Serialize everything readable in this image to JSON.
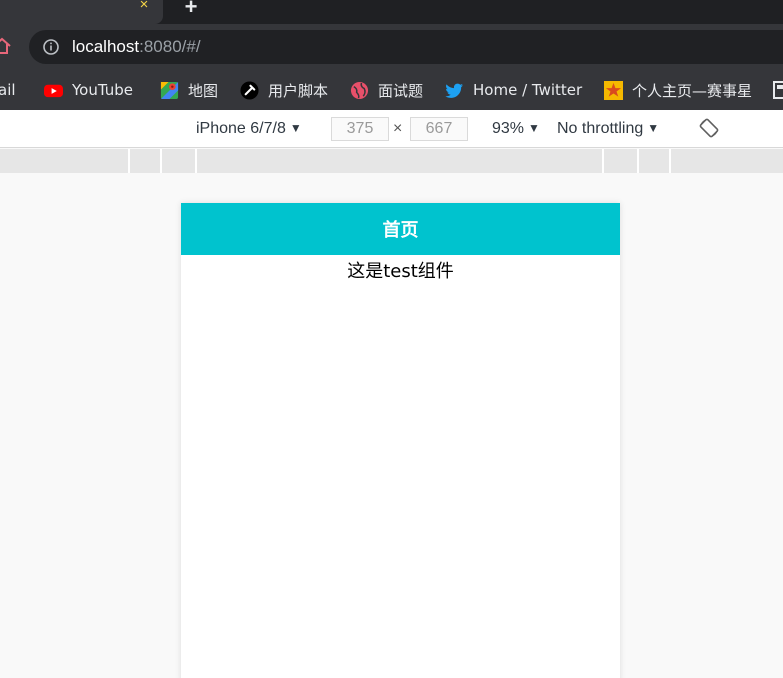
{
  "browser": {
    "tab_close_glyph": "×",
    "new_tab_glyph": "+",
    "address": {
      "host": "localhost",
      "rest": ":8080/#/"
    }
  },
  "bookmarks": [
    {
      "label": "ail",
      "icon": "gmail-icon"
    },
    {
      "label": "YouTube",
      "icon": "youtube-icon"
    },
    {
      "label": "地图",
      "icon": "maps-icon"
    },
    {
      "label": "用户脚本",
      "icon": "userscript-icon"
    },
    {
      "label": "面试题",
      "icon": "globe-icon"
    },
    {
      "label": "Home / Twitter",
      "icon": "twitter-icon"
    },
    {
      "label": "个人主页—赛事星",
      "icon": "saishixing-icon"
    }
  ],
  "devtools": {
    "device": "iPhone 6/7/8",
    "width": "375",
    "times": "×",
    "height": "667",
    "zoom": "93%",
    "throttling": "No throttling",
    "caret": "▼"
  },
  "app": {
    "header_title": "首页",
    "body_text": "这是test组件",
    "header_color": "#00c3ce"
  }
}
